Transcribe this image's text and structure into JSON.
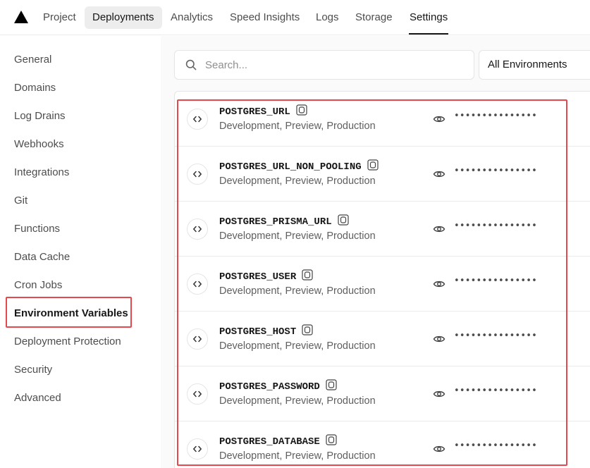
{
  "nav": {
    "tabs": [
      "Project",
      "Deployments",
      "Analytics",
      "Speed Insights",
      "Logs",
      "Storage",
      "Settings"
    ],
    "hovered": "Deployments",
    "active": "Settings"
  },
  "sidebar": {
    "items": [
      "General",
      "Domains",
      "Log Drains",
      "Webhooks",
      "Integrations",
      "Git",
      "Functions",
      "Data Cache",
      "Cron Jobs",
      "Environment Variables",
      "Deployment Protection",
      "Security",
      "Advanced"
    ],
    "active": "Environment Variables"
  },
  "search": {
    "placeholder": "Search...",
    "value": ""
  },
  "filter": {
    "environment": "All Environments"
  },
  "env_vars": [
    {
      "name": "POSTGRES_URL",
      "environments": "Development, Preview, Production",
      "value_masked": "•••••••••••••••"
    },
    {
      "name": "POSTGRES_URL_NON_POOLING",
      "environments": "Development, Preview, Production",
      "value_masked": "•••••••••••••••"
    },
    {
      "name": "POSTGRES_PRISMA_URL",
      "environments": "Development, Preview, Production",
      "value_masked": "•••••••••••••••"
    },
    {
      "name": "POSTGRES_USER",
      "environments": "Development, Preview, Production",
      "value_masked": "•••••••••••••••"
    },
    {
      "name": "POSTGRES_HOST",
      "environments": "Development, Preview, Production",
      "value_masked": "•••••••••••••••"
    },
    {
      "name": "POSTGRES_PASSWORD",
      "environments": "Development, Preview, Production",
      "value_masked": "•••••••••••••••"
    },
    {
      "name": "POSTGRES_DATABASE",
      "environments": "Development, Preview, Production",
      "value_masked": "•••••••••••••••"
    }
  ],
  "icons": {
    "logo": "triangle-logo-icon",
    "search": "search-icon",
    "row": "code-brackets-icon",
    "copy": "copy-icon",
    "reveal": "eye-icon"
  },
  "colors": {
    "highlight": "#e5484d",
    "text": "#171717",
    "muted": "#5f5f5f"
  }
}
